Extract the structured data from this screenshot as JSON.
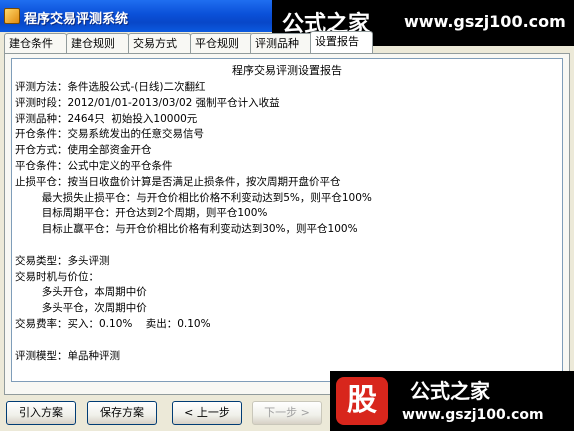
{
  "window": {
    "title": "程序交易评测系统"
  },
  "watermark": {
    "name": "公式之家",
    "url": "www.gszj100.com"
  },
  "tabs": [
    {
      "label": "建仓条件"
    },
    {
      "label": "建仓规则"
    },
    {
      "label": "交易方式"
    },
    {
      "label": "平仓规则"
    },
    {
      "label": "评测品种"
    },
    {
      "label": "设置报告"
    }
  ],
  "report": {
    "title": "程序交易评测设置报告",
    "lines": [
      "评测方法：条件选股公式-(日线)二次翻红",
      "评测时段：2012/01/01-2013/03/02 强制平仓计入收益",
      "评测品种：2464只  初始投入10000元",
      "开仓条件：交易系统发出的任意交易信号",
      "开仓方式：使用全部资金开仓",
      "平仓条件：公式中定义的平仓条件",
      "止损平仓：按当日收盘价计算是否满足止损条件，按次周期开盘价平仓",
      "        最大损失止损平仓：与开仓价相比价格不利变动达到5%，则平仓100%",
      "        目标周期平仓：开仓达到2个周期，则平仓100%",
      "        目标止赢平仓：与开仓价相比价格有利变动达到30%，则平仓100%",
      "",
      "交易类型：多头评测",
      "交易时机与价位：",
      "        多头开仓，本周期中价",
      "        多头平仓，次周期中价",
      "交易费率：买入：0.10%    卖出：0.10%",
      "",
      "评测模型：单品种评测"
    ]
  },
  "buttons": {
    "import": "引入方案",
    "save": "保存方案",
    "prev": "< 上一步",
    "next": "下一步 >"
  },
  "logo": {
    "glyph": "股",
    "name": "公式之家",
    "url": "www.gszj100.com"
  }
}
